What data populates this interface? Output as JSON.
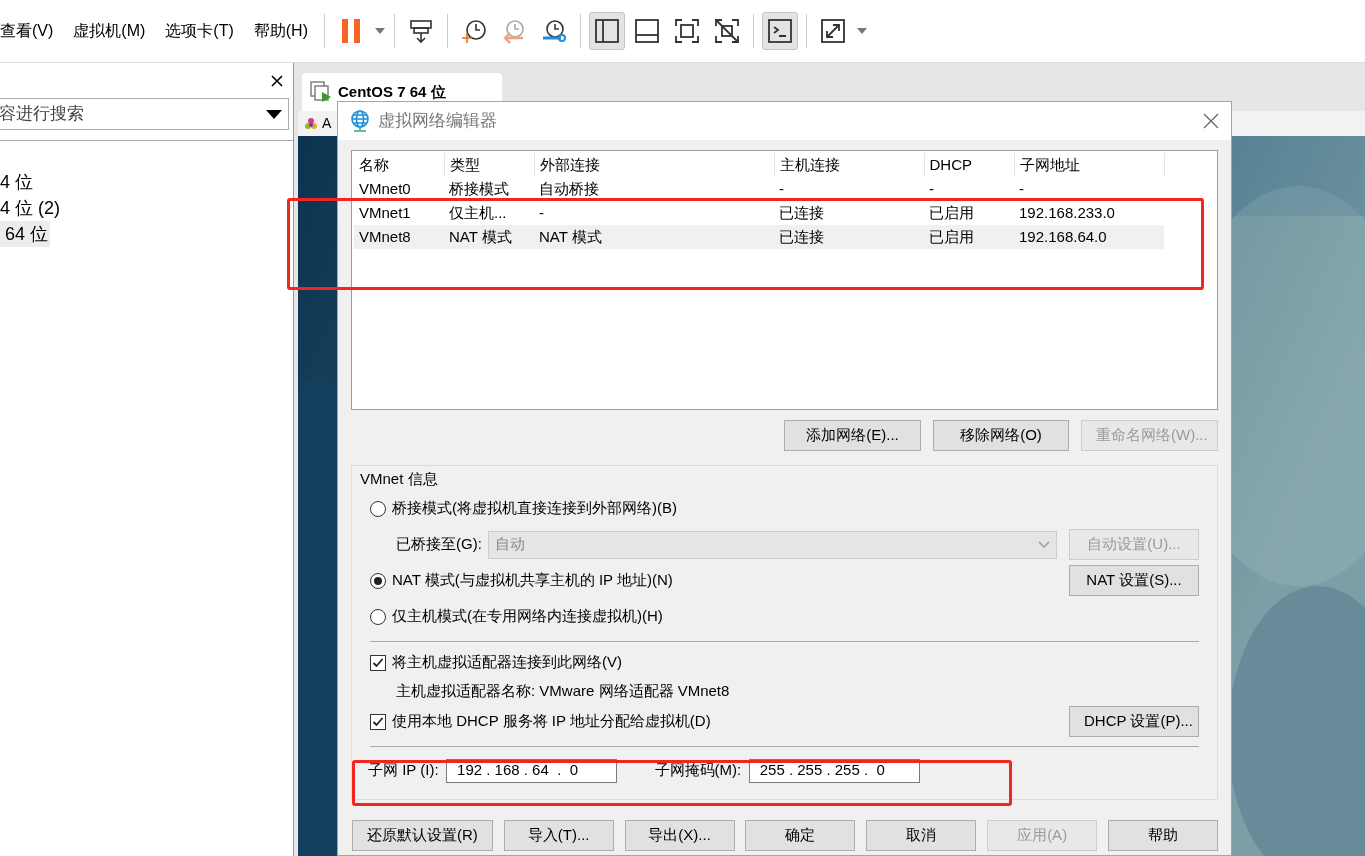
{
  "menu": [
    "查看(V)",
    "虚拟机(M)",
    "选项卡(T)",
    "帮助(H)"
  ],
  "toolbar": [
    {
      "kind": "pause",
      "selected": false
    },
    {
      "kind": "send",
      "selected": false
    },
    {
      "kind": "snapshot-take",
      "selected": false
    },
    {
      "kind": "snapshot-revert",
      "selected": false
    },
    {
      "kind": "snapshot-manage",
      "selected": false
    },
    {
      "kind": "view-library",
      "selected": true
    },
    {
      "kind": "view-thumb",
      "selected": false
    },
    {
      "kind": "view-full",
      "selected": false
    },
    {
      "kind": "view-unity",
      "selected": false
    },
    {
      "kind": "console",
      "selected": true
    },
    {
      "kind": "stretch",
      "selected": false
    }
  ],
  "sidebar": {
    "search": {
      "value": "容进行搜索"
    },
    "items": [
      {
        "label": "4 位",
        "selected": false
      },
      {
        "label": "4 位 (2)",
        "selected": false
      },
      {
        "label": " 64 位",
        "selected": true
      }
    ]
  },
  "tabs": [
    {
      "label": "CentOS 7 64 位",
      "selected": true
    }
  ],
  "vm_toolbar": {
    "text": "A"
  },
  "dialog": {
    "title": "虚拟网络编辑器",
    "table": {
      "columns": [
        "名称",
        "类型",
        "外部连接",
        "主机连接",
        "DHCP",
        "子网地址"
      ],
      "rows": [
        {
          "cells": [
            "VMnet0",
            "桥接模式",
            "自动桥接",
            "-",
            "-",
            "-"
          ],
          "selected": false
        },
        {
          "cells": [
            "VMnet1",
            "仅主机...",
            "-",
            "已连接",
            "已启用",
            "192.168.233.0"
          ],
          "selected": false
        },
        {
          "cells": [
            "VMnet8",
            "NAT 模式",
            "NAT 模式",
            "已连接",
            "已启用",
            "192.168.64.0"
          ],
          "selected": true
        }
      ]
    },
    "actions": [
      {
        "label": "添加网络(E)...",
        "disabled": false
      },
      {
        "label": "移除网络(O)",
        "disabled": false
      },
      {
        "label": "重命名网络(W)...",
        "disabled": true
      }
    ],
    "info": {
      "title": "VMnet 信息",
      "modes": [
        {
          "label": "桥接模式(将虚拟机直接连接到外部网络)(B)",
          "selected": false
        },
        {
          "label": "NAT 模式(与虚拟机共享主机的 IP 地址)(N)",
          "selected": true
        },
        {
          "label": "仅主机模式(在专用网络内连接虚拟机)(H)",
          "selected": false
        }
      ],
      "bridged_to": {
        "label": "已桥接至(G):",
        "value": "自动",
        "disabled": true
      },
      "auto_button": {
        "label": "自动设置(U)...",
        "disabled": true
      },
      "nat_button": {
        "label": "NAT 设置(S)...",
        "disabled": false
      },
      "connect_adapter": {
        "label": "将主机虚拟适配器连接到此网络(V)",
        "checked": true
      },
      "adapter_name": "主机虚拟适配器名称: VMware 网络适配器 VMnet8",
      "dhcp": {
        "label": "使用本地 DHCP 服务将 IP 地址分配给虚拟机(D)",
        "checked": true
      },
      "dhcp_button": {
        "label": "DHCP 设置(P)...",
        "disabled": false
      },
      "subnet_ip": {
        "label": "子网 IP (I):",
        "value": "192 . 168 . 64  .  0"
      },
      "subnet_mask": {
        "label": "子网掩码(M):",
        "value": "255 . 255 . 255 .  0"
      }
    },
    "footer": [
      {
        "label": "还原默认设置(R)",
        "disabled": false
      },
      {
        "label": "导入(T)...",
        "disabled": false
      },
      {
        "label": "导出(X)...",
        "disabled": false
      },
      {
        "label": "确定",
        "disabled": false
      },
      {
        "label": "取消",
        "disabled": false
      },
      {
        "label": "应用(A)",
        "disabled": true
      },
      {
        "label": "帮助",
        "disabled": false
      }
    ]
  }
}
